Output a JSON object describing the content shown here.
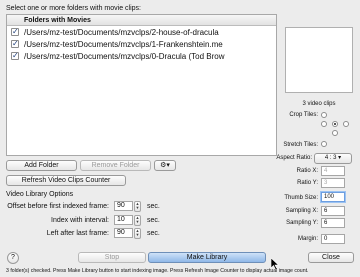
{
  "header": {
    "instruction": "Select one or more folders with movie clips:"
  },
  "table": {
    "column": "Folders with Movies",
    "rows": [
      "/Users/mz-test/Documents/mzvclps/2-house-of-dracula",
      "/Users/mz-test/Documents/mzvclps/1-Frankenshtein.me",
      "/Users/mz-test/Documents/mzvclps/0-Dracula (Tod Brow"
    ]
  },
  "buttons": {
    "add_folder": "Add Folder",
    "remove_folder": "Remove Folder",
    "gear_menu": "⚙▾",
    "refresh": "Refresh Video Clips Counter",
    "stop": "Stop",
    "make_library": "Make Library",
    "close": "Close",
    "help": "?"
  },
  "options": {
    "title": "Video Library Options",
    "offset_label": "Offset before first indexed frame:",
    "offset_value": "90",
    "interval_label": "Index with interval:",
    "interval_value": "10",
    "left_label": "Left after last frame:",
    "left_value": "90",
    "unit": "sec."
  },
  "right_panel": {
    "clips_count": "3 video clips",
    "crop_tiles_label": "Crop Tiles:",
    "stretch_tiles_label": "Stretch Tiles:",
    "aspect_label": "Aspect Ratio:",
    "aspect_value": "4 : 3",
    "ratio_x_label": "Ratio X:",
    "ratio_x_value": "4",
    "ratio_y_label": "Ratio Y:",
    "ratio_y_value": "3",
    "thumb_label": "Thumb Size:",
    "thumb_value": "100",
    "sampling_x_label": "Sampling X:",
    "sampling_x_value": "6",
    "sampling_y_label": "Sampling Y:",
    "sampling_y_value": "6",
    "margin_label": "Margin:",
    "margin_value": "0"
  },
  "status": "3 folder(s) checked. Press Make Library button to start indexing image. Press Refresh Image Counter to display actual image count."
}
